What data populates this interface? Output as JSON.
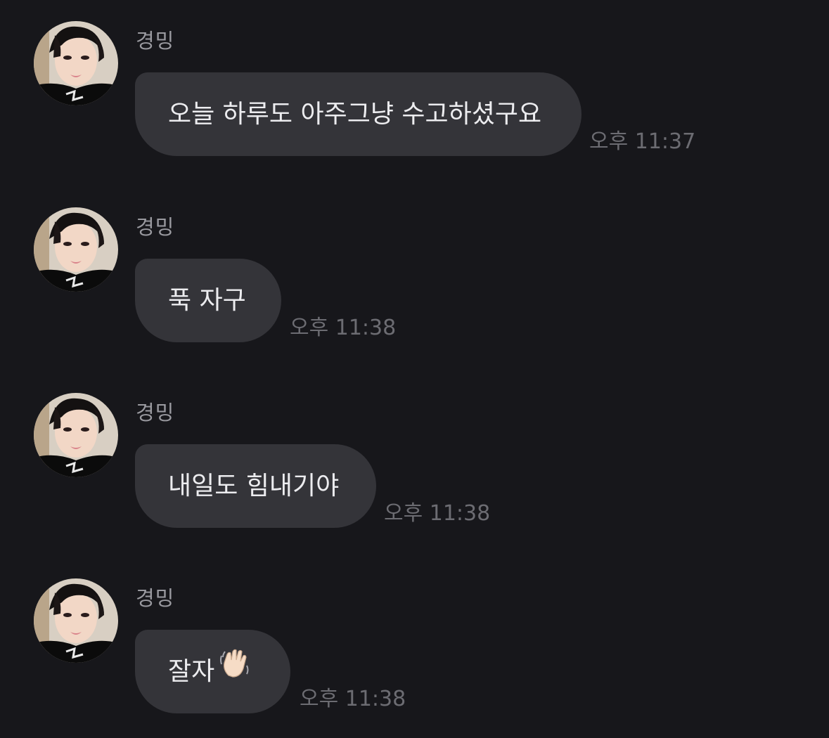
{
  "messages": [
    {
      "sender": "경밍",
      "text": "오늘 하루도 아주그냥 수고하셨구요",
      "time": "오후 11:37",
      "avatar": "avatar"
    },
    {
      "sender": "경밍",
      "text": "푹 자구",
      "time": "오후 11:38",
      "avatar": "avatar"
    },
    {
      "sender": "경밍",
      "text": "내일도 힘내기야",
      "time": "오후 11:38",
      "avatar": "avatar"
    },
    {
      "sender": "경밍",
      "text": "잘자",
      "emoji": "waving-hand",
      "time": "오후 11:38",
      "avatar": "avatar"
    }
  ],
  "colors": {
    "background": "#17171b",
    "bubble": "#343439",
    "text": "#ececef",
    "sender": "#9a9aa0",
    "time": "#6c6c72"
  }
}
